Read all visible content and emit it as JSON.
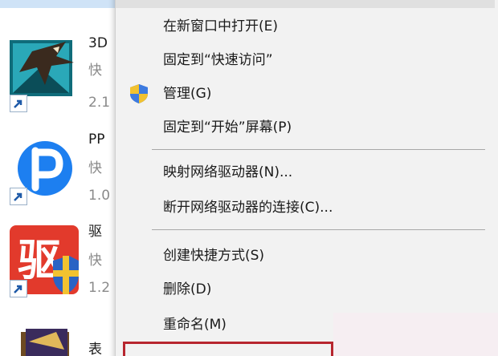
{
  "file_list": {
    "items": [
      {
        "name": "3D",
        "type": "快",
        "size": "2.1",
        "icon": "eagle-3d-app-icon",
        "is_shortcut": true
      },
      {
        "name": "PP",
        "type": "快",
        "size": "1.0",
        "icon": "pp-assistant-icon",
        "is_shortcut": true
      },
      {
        "name": "驱",
        "type": "快",
        "size": "1.2",
        "icon": "driver-app-icon",
        "is_shortcut": true
      },
      {
        "name": "表",
        "icon": "app-icon-partial",
        "is_shortcut": false
      }
    ]
  },
  "context_menu": {
    "items": [
      {
        "label": "在新窗口中打开(E)",
        "icon": null
      },
      {
        "label": "固定到“快速访问”",
        "icon": null
      },
      {
        "label": "管理(G)",
        "icon": "uac-shield-icon"
      },
      {
        "label": "固定到“开始”屏幕(P)",
        "icon": null
      },
      {
        "label": "映射网络驱动器(N)...",
        "icon": null
      },
      {
        "label": "断开网络驱动器的连接(C)...",
        "icon": null
      },
      {
        "label": "创建快捷方式(S)",
        "icon": null
      },
      {
        "label": "删除(D)",
        "icon": null
      },
      {
        "label": "重命名(M)",
        "icon": null
      }
    ],
    "highlighted_index": 9
  },
  "colors": {
    "menu_background": "#f2f2f2",
    "separator": "#a8a8a8",
    "highlight_box": "#b7262f",
    "selection_blue": "#cfe3f7"
  }
}
